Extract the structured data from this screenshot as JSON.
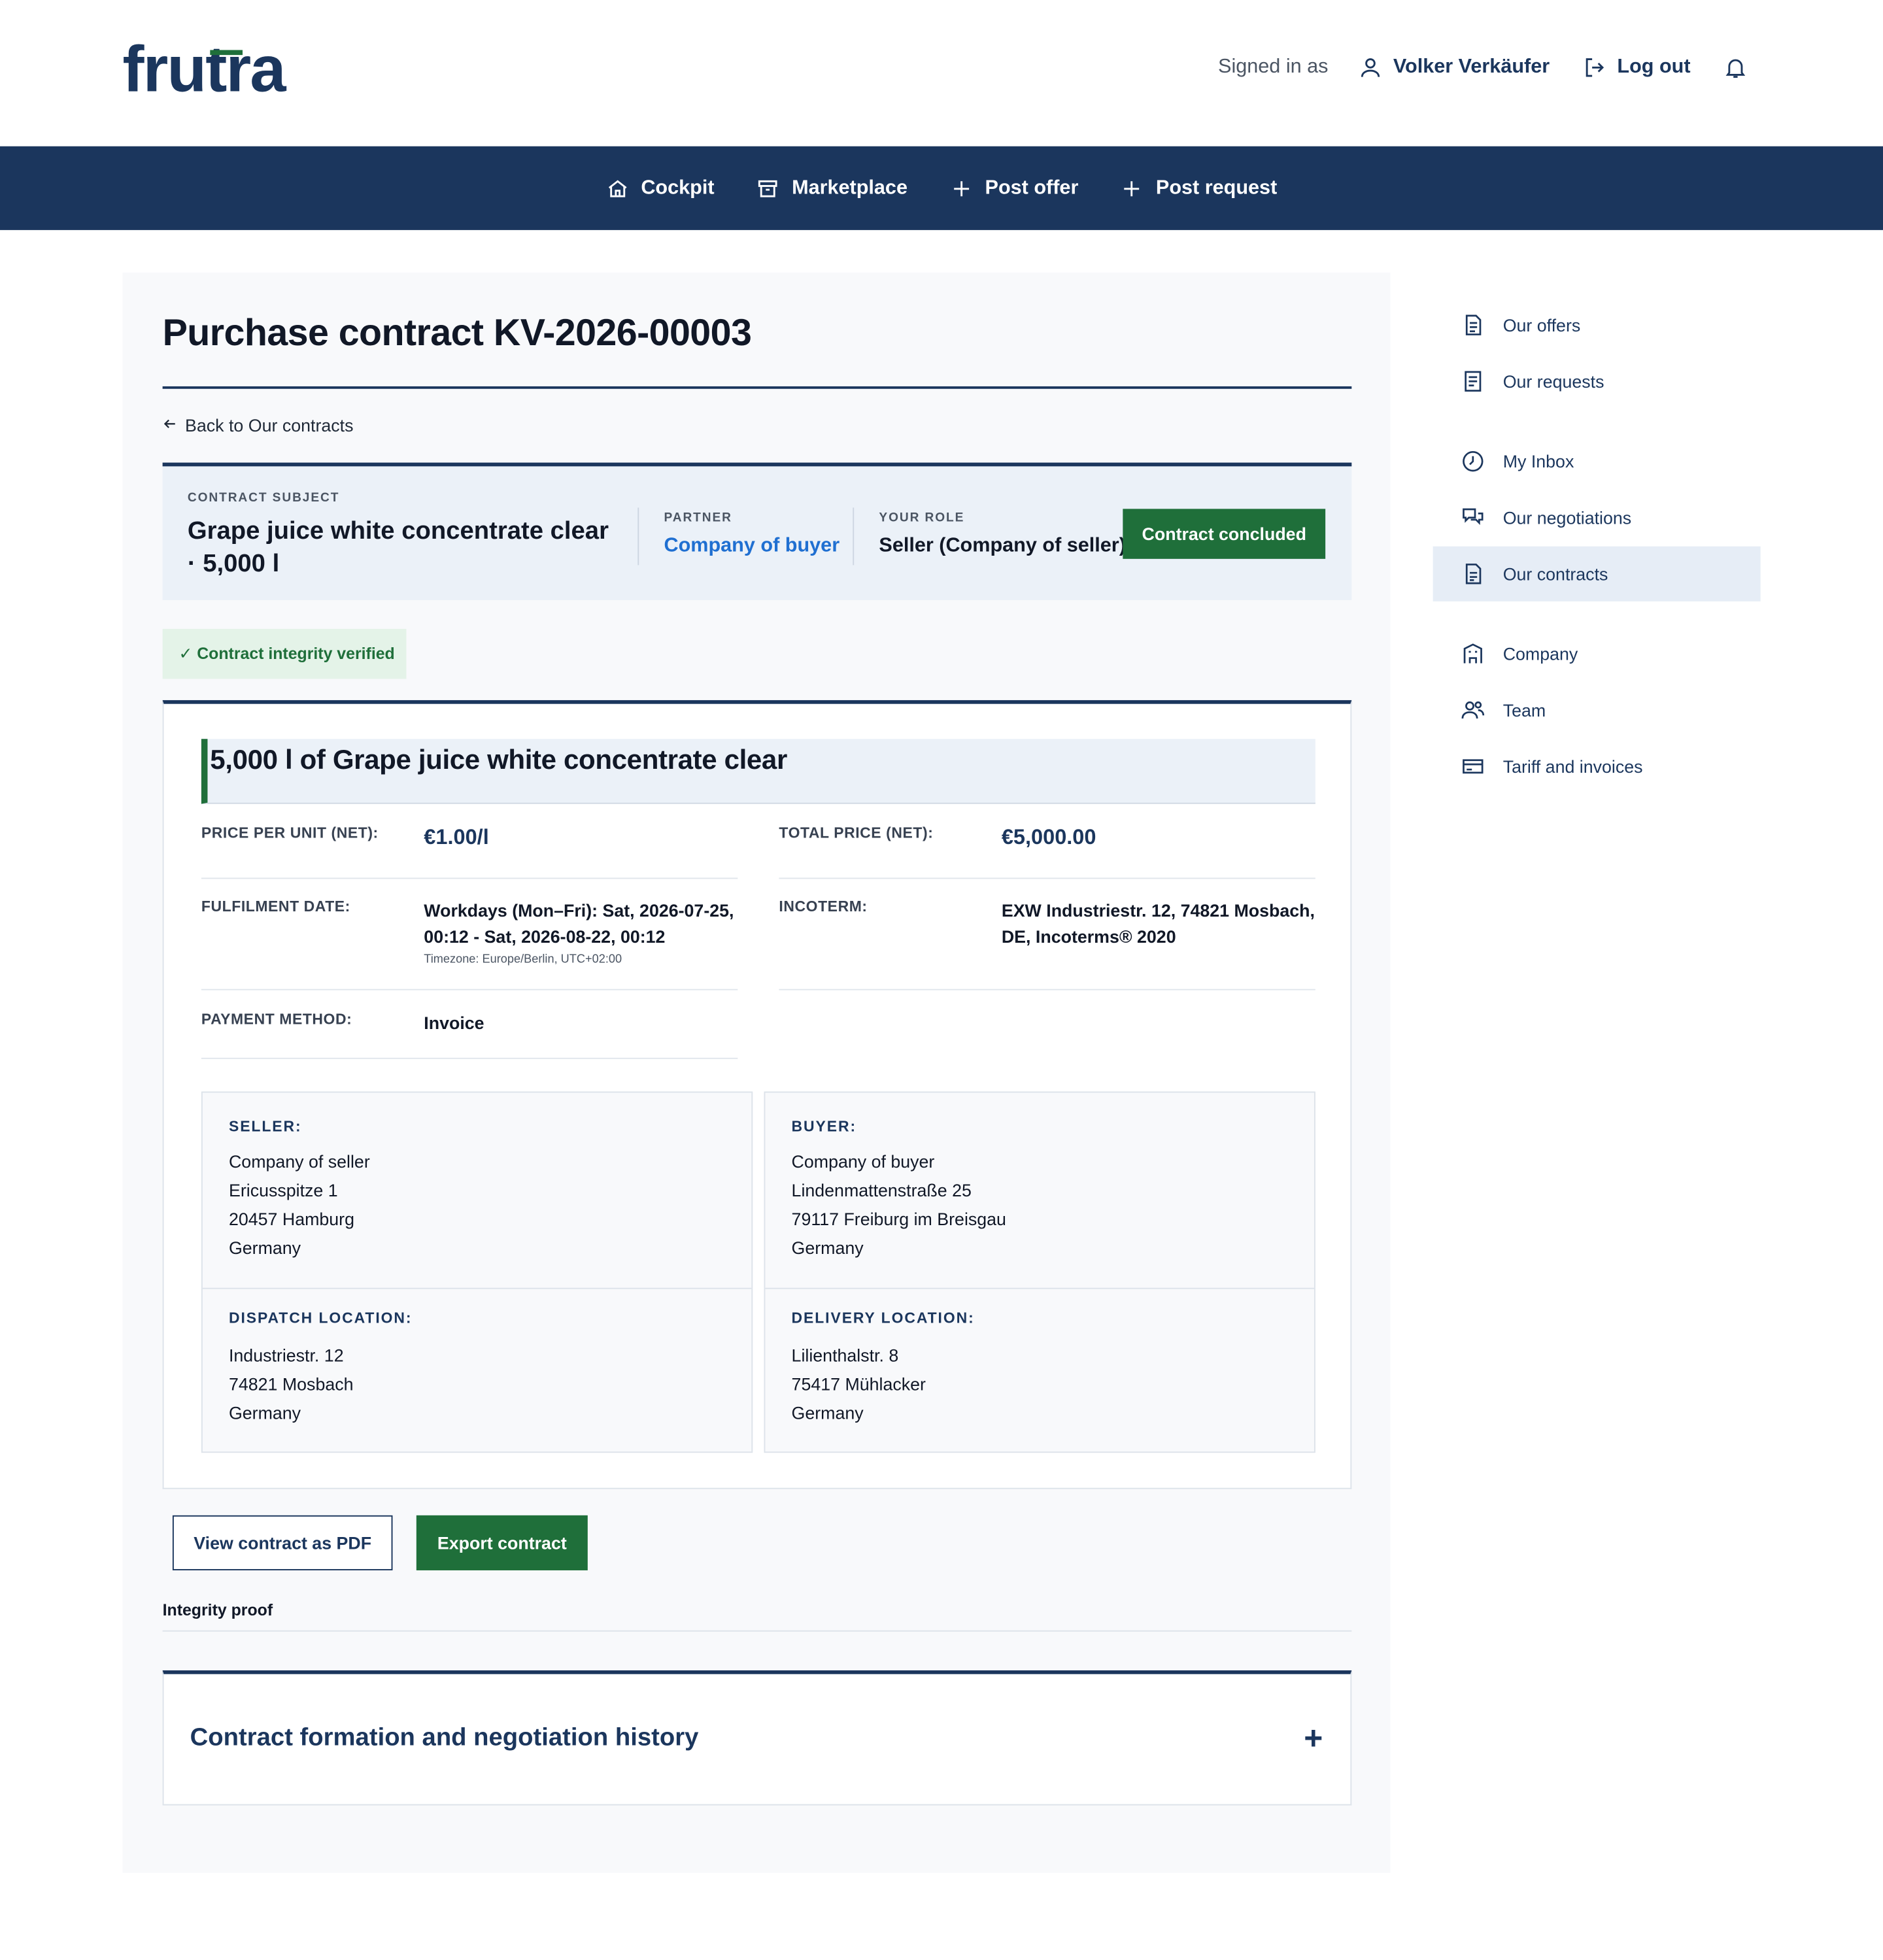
{
  "app": {
    "logo": "frutra"
  },
  "header": {
    "signed_in_label": "Signed in as",
    "user_name": "Volker Verkäufer",
    "logout_label": "Log out"
  },
  "nav": {
    "items": [
      {
        "label": "Cockpit",
        "icon": "home-icon"
      },
      {
        "label": "Marketplace",
        "icon": "archive-box-icon"
      },
      {
        "label": "Post offer",
        "icon": "plus-icon"
      },
      {
        "label": "Post request",
        "icon": "plus-icon"
      }
    ]
  },
  "page": {
    "title": "Purchase contract KV-2026-00003",
    "back_label": "Back to Our contracts"
  },
  "summary": {
    "subject_caption": "CONTRACT SUBJECT",
    "subject_line1": "Grape juice white concentrate clear",
    "subject_line2": "· 5,000 l",
    "partner_caption": "PARTNER",
    "partner_value": "Company of buyer",
    "role_caption": "YOUR ROLE",
    "role_value": "Seller (Company of seller)",
    "status": "Contract concluded"
  },
  "integrity_badge": "✓ Contract integrity verified",
  "contract": {
    "heading": "5,000 l of Grape juice white concentrate clear",
    "fields": {
      "price_per_unit": {
        "label": "PRICE PER UNIT (NET):",
        "value": "€1.00/l"
      },
      "total_price": {
        "label": "TOTAL PRICE (NET):",
        "value": "€5,000.00"
      },
      "fulfilment": {
        "label": "FULFILMENT DATE:",
        "value": "Workdays (Mon–Fri): Sat, 2026-07-25, 00:12 - Sat, 2026-08-22, 00:12",
        "timezone": "Timezone: Europe/Berlin, UTC+02:00"
      },
      "incoterm": {
        "label": "INCOTERM:",
        "value": "EXW Industriestr. 12, 74821 Mosbach, DE, Incoterms® 2020"
      },
      "payment": {
        "label": "PAYMENT METHOD:",
        "value": "Invoice"
      }
    },
    "seller": {
      "heading": "SELLER:",
      "lines": [
        "Company of seller",
        "Ericusspitze 1",
        "20457 Hamburg",
        "Germany"
      ]
    },
    "buyer": {
      "heading": "BUYER:",
      "lines": [
        "Company of buyer",
        "Lindenmattenstraße 25",
        "79117 Freiburg im Breisgau",
        "Germany"
      ]
    },
    "dispatch": {
      "heading": "DISPATCH LOCATION:",
      "lines": [
        "Industriestr. 12",
        "74821 Mosbach",
        "Germany"
      ]
    },
    "delivery": {
      "heading": "DELIVERY LOCATION:",
      "lines": [
        "Lilienthalstr. 8",
        "75417 Mühlacker",
        "Germany"
      ]
    }
  },
  "actions": {
    "view_pdf": "View contract as PDF",
    "export": "Export contract",
    "integrity_proof": "Integrity proof"
  },
  "history": {
    "title": "Contract formation and negotiation history",
    "toggle": "+"
  },
  "sidebar": {
    "items": [
      {
        "label": "Our offers",
        "icon": "document-icon"
      },
      {
        "label": "Our requests",
        "icon": "list-document-icon"
      },
      {
        "label": "My Inbox",
        "icon": "clock-icon"
      },
      {
        "label": "Our negotiations",
        "icon": "chat-bubbles-icon"
      },
      {
        "label": "Our contracts",
        "icon": "contract-document-icon",
        "active": true
      },
      {
        "label": "Company",
        "icon": "building-icon"
      },
      {
        "label": "Team",
        "icon": "users-icon"
      },
      {
        "label": "Tariff and invoices",
        "icon": "credit-card-icon"
      }
    ]
  },
  "colors": {
    "navy": "#1b365d",
    "green": "#1f6f3a",
    "link_blue": "#1f6fd1",
    "panel_bg": "#f8f9fb",
    "summary_bg": "#ebf1f8"
  }
}
